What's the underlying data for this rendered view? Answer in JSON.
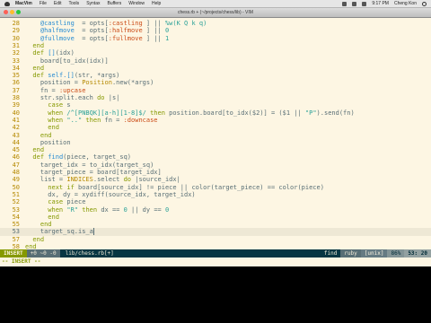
{
  "menubar": {
    "app": "MacVim",
    "items": [
      "File",
      "Edit",
      "Tools",
      "Syntax",
      "Buffers",
      "Window",
      "Help"
    ],
    "clock": "9:17 PM",
    "user": "Cheng Kon"
  },
  "window": {
    "title": "chess.rb + (~/projects/chess/lib) - VIM"
  },
  "editor": {
    "lines": [
      {
        "num": "28",
        "code": [
          [
            "iv",
            "    @castling"
          ],
          [
            "",
            "  = opts["
          ],
          [
            "sym",
            ":castling"
          ],
          [
            "",
            " ] || "
          ],
          [
            "str",
            "%w(K Q k q)"
          ]
        ]
      },
      {
        "num": "29",
        "code": [
          [
            "iv",
            "    @halfmove"
          ],
          [
            "",
            "  = opts["
          ],
          [
            "sym",
            ":halfmove"
          ],
          [
            "",
            " ] || "
          ],
          [
            "num",
            "0"
          ]
        ]
      },
      {
        "num": "30",
        "code": [
          [
            "iv",
            "    @fullmove"
          ],
          [
            "",
            "  = opts["
          ],
          [
            "sym",
            ":fullmove"
          ],
          [
            "",
            " ] || "
          ],
          [
            "num",
            "1"
          ]
        ]
      },
      {
        "num": "31",
        "code": [
          [
            "kw",
            "  end"
          ]
        ]
      },
      {
        "num": "32",
        "code": [
          [
            "kw",
            "  def "
          ],
          [
            "fn",
            "[]"
          ],
          [
            "",
            "(idx)"
          ]
        ]
      },
      {
        "num": "33",
        "code": [
          [
            "",
            "    board[to_idx(idx)]"
          ]
        ]
      },
      {
        "num": "34",
        "code": [
          [
            "kw",
            "  end"
          ]
        ]
      },
      {
        "num": "35",
        "code": [
          [
            "kw",
            "  def "
          ],
          [
            "fn",
            "self.[]"
          ],
          [
            "",
            "(str, *args)"
          ]
        ]
      },
      {
        "num": "36",
        "code": [
          [
            "",
            "    position = "
          ],
          [
            "cls",
            "Position"
          ],
          [
            "",
            ".new(*args)"
          ]
        ]
      },
      {
        "num": "37",
        "code": [
          [
            "",
            "    fn = "
          ],
          [
            "sym",
            ":upcase"
          ]
        ]
      },
      {
        "num": "38",
        "code": [
          [
            "",
            "    str.split.each "
          ],
          [
            "kw",
            "do"
          ],
          [
            "",
            " |s|"
          ]
        ]
      },
      {
        "num": "39",
        "code": [
          [
            "kw",
            "      case "
          ],
          [
            "",
            "s"
          ]
        ]
      },
      {
        "num": "40",
        "code": [
          [
            "kw",
            "      when "
          ],
          [
            "str",
            "/^[PNBQK][a-h][1-8]$/"
          ],
          [
            "kw",
            " then "
          ],
          [
            "",
            "position.board[to_idx($2)] = ($1 || "
          ],
          [
            "str",
            "\"P\""
          ],
          [
            "",
            ").send(fn)"
          ]
        ]
      },
      {
        "num": "41",
        "code": [
          [
            "kw",
            "      when "
          ],
          [
            "str",
            "\"..\""
          ],
          [
            "kw",
            " then "
          ],
          [
            "",
            "fn = "
          ],
          [
            "sym",
            ":downcase"
          ]
        ]
      },
      {
        "num": "42",
        "code": [
          [
            "kw",
            "      end"
          ]
        ]
      },
      {
        "num": "43",
        "code": [
          [
            "kw",
            "    end"
          ]
        ]
      },
      {
        "num": "44",
        "code": [
          [
            "",
            "    position"
          ]
        ]
      },
      {
        "num": "45",
        "code": [
          [
            "kw",
            "  end"
          ]
        ]
      },
      {
        "num": "46",
        "code": [
          [
            "kw",
            "  def "
          ],
          [
            "fn",
            "find"
          ],
          [
            "",
            "(piece, target_sq)"
          ]
        ]
      },
      {
        "num": "47",
        "code": [
          [
            "",
            "    target_idx = to_idx(target_sq)"
          ]
        ]
      },
      {
        "num": "48",
        "code": [
          [
            "",
            "    target_piece = board[target_idx]"
          ]
        ]
      },
      {
        "num": "49",
        "code": [
          [
            "",
            "    list = "
          ],
          [
            "cls",
            "INDICES"
          ],
          [
            "",
            ".select "
          ],
          [
            "kw",
            "do"
          ],
          [
            "",
            " |source_idx|"
          ]
        ]
      },
      {
        "num": "50",
        "code": [
          [
            "kw",
            "      next if "
          ],
          [
            "",
            "board[source_idx] != piece || color(target_piece) == color(piece)"
          ]
        ]
      },
      {
        "num": "51",
        "code": [
          [
            "",
            "      dx, dy = xydiff(source_idx, target_idx)"
          ]
        ]
      },
      {
        "num": "52",
        "code": [
          [
            "kw",
            "      case "
          ],
          [
            "",
            "piece"
          ]
        ]
      },
      {
        "num": "53",
        "code": [
          [
            "kw",
            "      when "
          ],
          [
            "str",
            "\"R\""
          ],
          [
            "kw",
            " then "
          ],
          [
            "",
            "dx == "
          ],
          [
            "num",
            "0"
          ],
          [
            "",
            " || dy == "
          ],
          [
            "num",
            "0"
          ]
        ]
      },
      {
        "num": "54",
        "code": [
          [
            "kw",
            "      end"
          ]
        ]
      },
      {
        "num": "55",
        "code": [
          [
            "kw",
            "    end"
          ]
        ]
      },
      {
        "num": "53",
        "code": [
          [
            "",
            "    target_sq.is_a"
          ]
        ],
        "current": true
      },
      {
        "num": "57",
        "code": [
          [
            "kw",
            "  end"
          ]
        ]
      },
      {
        "num": "58",
        "code": [
          [
            "kw",
            "end"
          ]
        ]
      }
    ]
  },
  "statusline": {
    "mode": "INSERT",
    "git": "+0 ~0 -0",
    "file": "lib/chess.rb[+]",
    "func": "find",
    "filetype": "ruby",
    "fileformat": "[unix]",
    "percent": "86%",
    "position": "53: 20"
  },
  "cmdline": {
    "text": "-- INSERT --"
  },
  "colors": {
    "editor_bg": "#fdf6e3",
    "keyword": "#859900",
    "ivar": "#268bd2",
    "symbol": "#cb4b16",
    "string": "#2aa198",
    "statusline_bg": "#073642"
  }
}
